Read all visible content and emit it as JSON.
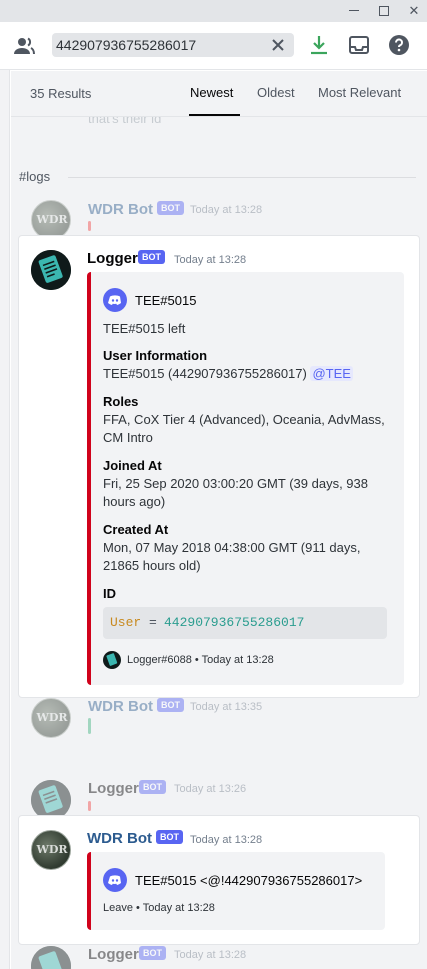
{
  "window": {
    "minimize_icon": "minimize-icon",
    "maximize_icon": "maximize-icon",
    "close_glyph": "✕"
  },
  "topbar": {
    "search_value": "442907936755286017",
    "icons": [
      "members-icon",
      "search-clear-icon",
      "download-icon",
      "inbox-icon",
      "help-icon"
    ]
  },
  "results_header": {
    "count": "35 Results",
    "tabs": [
      "Newest",
      "Oldest",
      "Most Relevant"
    ],
    "active_tab": "Newest"
  },
  "results": {
    "ghost_text": "that's their id",
    "channel": "#logs",
    "ctx_top": {
      "author": "WDR Bot",
      "tag": "BOT",
      "time": "Today at 13:28",
      "avatar_text": "WDR",
      "bar_color": "#f04747"
    },
    "main": {
      "author": "Logger",
      "tag": "BOT",
      "time": "Today at 13:28",
      "embed": {
        "author": "TEE#5015",
        "description": "TEE#5015 left",
        "fields": [
          {
            "name": "User Information",
            "value": "TEE#5015 (442907936755286017)",
            "mention": "@TEE"
          },
          {
            "name": "Roles",
            "value_line1": "FFA, CoX Tier 4 (Advanced), Oceania, AdvMass,",
            "value_line2": "CM Intro"
          },
          {
            "name": "Joined At",
            "value_line1": "Fri, 25 Sep 2020 03:00:20 GMT (39 days, 938",
            "value_line2": "hours ago)"
          },
          {
            "name": "Created At",
            "value_line1": "Mon, 07 May 2018 04:38:00 GMT (911 days,",
            "value_line2": "21865 hours old)"
          },
          {
            "name": "ID",
            "code_key": "User",
            "code_eq": "=",
            "code_val": "442907936755286017"
          }
        ],
        "footer": "Logger#6088 • Today at 13:28",
        "color": "#d0021b"
      }
    },
    "ctx_mid": {
      "author": "WDR Bot",
      "tag": "BOT",
      "time": "Today at 13:35",
      "avatar_text": "WDR",
      "bar_color": "#43b581"
    },
    "ctx_mid2": {
      "author": "Logger",
      "tag": "BOT",
      "time": "Today at 13:26",
      "bar_color": "#f04747"
    },
    "second": {
      "author": "WDR Bot",
      "tag": "BOT",
      "time": "Today at 13:28",
      "avatar_text": "WDR",
      "embed": {
        "author": "TEE#5015 <@!442907936755286017>",
        "footer": "Leave • Today at 13:28",
        "color": "#d0021b"
      }
    },
    "ctx_bottom": {
      "author": "Logger",
      "tag": "BOT",
      "time": "Today at 13:28"
    }
  }
}
